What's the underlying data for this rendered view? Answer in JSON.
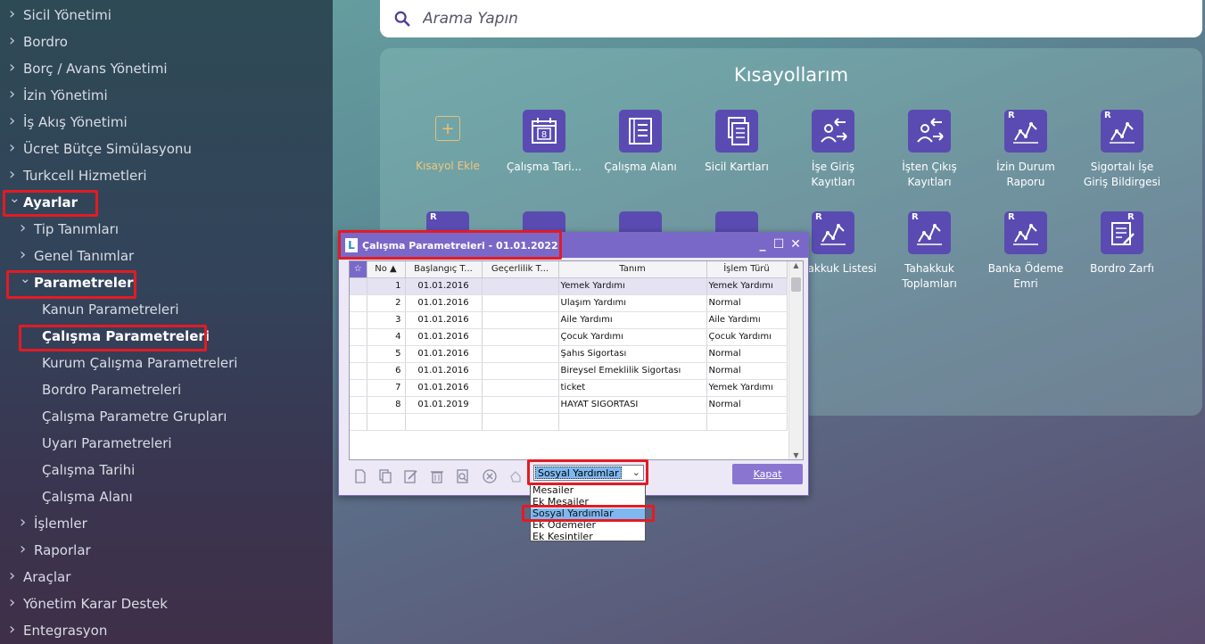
{
  "sidebar": {
    "items": [
      {
        "label": "Sicil Yönetimi",
        "level": 0,
        "expanded": false
      },
      {
        "label": "Bordro",
        "level": 0,
        "expanded": false
      },
      {
        "label": "Borç / Avans Yönetimi",
        "level": 0,
        "expanded": false
      },
      {
        "label": "İzin Yönetimi",
        "level": 0,
        "expanded": false
      },
      {
        "label": "İş Akış Yönetimi",
        "level": 0,
        "expanded": false
      },
      {
        "label": "Ücret Bütçe Simülasyonu",
        "level": 0,
        "expanded": false
      },
      {
        "label": "Turkcell Hizmetleri",
        "level": 0,
        "expanded": false
      },
      {
        "label": "Ayarlar",
        "level": 0,
        "expanded": true
      },
      {
        "label": "Tip Tanımları",
        "level": 1,
        "expanded": false
      },
      {
        "label": "Genel Tanımlar",
        "level": 1,
        "expanded": false
      },
      {
        "label": "Parametreler",
        "level": 1,
        "expanded": true
      },
      {
        "label": "Kanun Parametreleri",
        "level": 2
      },
      {
        "label": "Çalışma Parametreleri",
        "level": 2,
        "active": true
      },
      {
        "label": "Kurum Çalışma Parametreleri",
        "level": 2
      },
      {
        "label": "Bordro Parametreleri",
        "level": 2
      },
      {
        "label": "Çalışma Parametre Grupları",
        "level": 2
      },
      {
        "label": "Uyarı Parametreleri",
        "level": 2
      },
      {
        "label": "Çalışma Tarihi",
        "level": 2
      },
      {
        "label": "Çalışma Alanı",
        "level": 2
      },
      {
        "label": "İşlemler",
        "level": 1,
        "expanded": false
      },
      {
        "label": "Raporlar",
        "level": 1,
        "expanded": false
      },
      {
        "label": "Araçlar",
        "level": 0,
        "expanded": false
      },
      {
        "label": "Yönetim Karar Destek",
        "level": 0,
        "expanded": false
      },
      {
        "label": "Entegrasyon",
        "level": 0,
        "expanded": false
      }
    ]
  },
  "search": {
    "placeholder": "Arama Yapın",
    "icon": "search-icon"
  },
  "shortcuts": {
    "title": "Kısayollarım",
    "add_label": "Kısayol Ekle",
    "tiles": [
      {
        "label": "Çalışma Tari...",
        "icon": "calendar-icon"
      },
      {
        "label": "Çalışma Alanı",
        "icon": "list-icon"
      },
      {
        "label": "Sicil Kartları",
        "icon": "document-icon"
      },
      {
        "label": "İşe Giriş Kayıtları",
        "icon": "user-arrows-icon"
      },
      {
        "label": "İşten Çıkış Kayıtları",
        "icon": "user-arrows-icon"
      },
      {
        "label": "İzin Durum Raporu",
        "icon": "report-chart-icon"
      },
      {
        "label": "Sigortalı İşe Giriş Bildirgesi",
        "icon": "report-chart-icon"
      },
      {
        "label": "Tahakkuk Listesi",
        "icon": "report-chart-icon"
      },
      {
        "label": "Tahakkuk Toplamları",
        "icon": "report-chart-icon"
      },
      {
        "label": "Banka Ödeme Emri",
        "icon": "report-chart-icon"
      },
      {
        "label": "Bordro Zarfı",
        "icon": "envelope-report-icon"
      }
    ],
    "report_badge": "R"
  },
  "dialog": {
    "title": "Çalışma Parametreleri - 01.01.2022",
    "columns": [
      "No",
      "Başlangıç T...",
      "Geçerlilik T...",
      "Tanım",
      "İşlem Türü"
    ],
    "rows": [
      {
        "no": "1",
        "start": "01.01.2016",
        "valid": "",
        "name": "Yemek Yardımı",
        "type": "Yemek Yardımı"
      },
      {
        "no": "2",
        "start": "01.01.2016",
        "valid": "",
        "name": "Ulaşım Yardımı",
        "type": "Normal"
      },
      {
        "no": "3",
        "start": "01.01.2016",
        "valid": "",
        "name": "Aile Yardımı",
        "type": "Aile Yardımı"
      },
      {
        "no": "4",
        "start": "01.01.2016",
        "valid": "",
        "name": "Çocuk Yardımı",
        "type": "Çocuk Yardımı"
      },
      {
        "no": "5",
        "start": "01.01.2016",
        "valid": "",
        "name": "Şahıs Sigortası",
        "type": "Normal"
      },
      {
        "no": "6",
        "start": "01.01.2016",
        "valid": "",
        "name": "Bireysel Emeklilik Sigortası",
        "type": "Normal"
      },
      {
        "no": "7",
        "start": "01.01.2016",
        "valid": "",
        "name": "ticket",
        "type": "Yemek Yardımı"
      },
      {
        "no": "8",
        "start": "01.01.2019",
        "valid": "",
        "name": "HAYAT SIGORTASI",
        "type": "Normal"
      }
    ],
    "combo_value": "Sosyal Yardımlar",
    "close_label": "Kapat",
    "dropdown_options": [
      "Mesailer",
      "Ek Mesailer",
      "Sosyal Yardımlar",
      "Ek Ödemeler",
      "Ek Kesintiler"
    ],
    "selected_option_index": 2
  },
  "colors": {
    "highlight": "#e31b23",
    "accent": "#5a4bb2",
    "dialog_title": "#7a68c8"
  }
}
